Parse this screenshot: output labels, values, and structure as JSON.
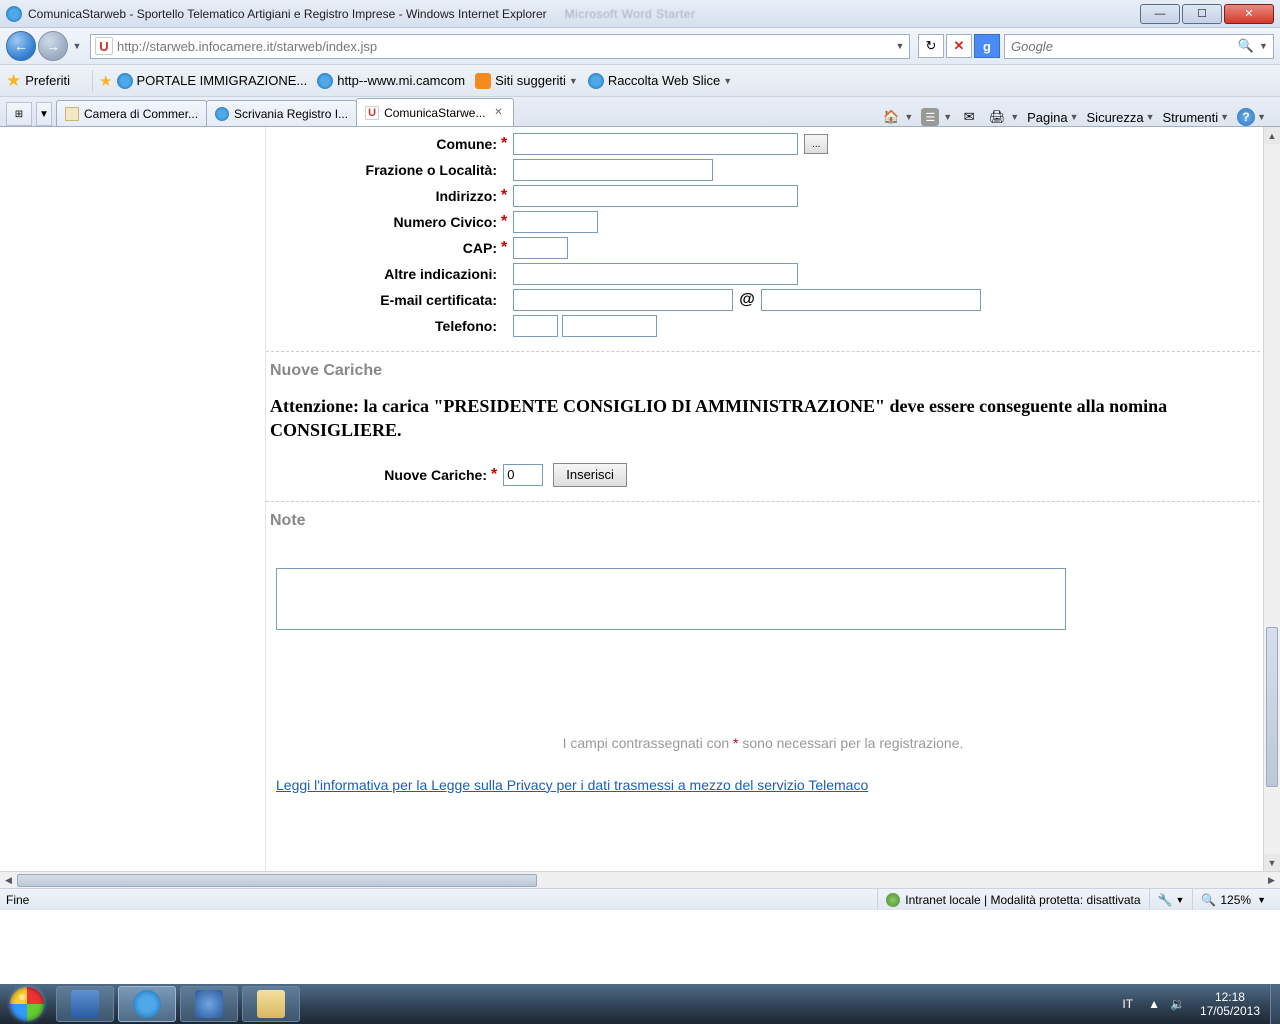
{
  "window": {
    "title": "ComunicaStarweb - Sportello Telematico Artigiani e Registro Imprese - Windows Internet Explorer",
    "blurred_inactive": "Microsoft Word Starter"
  },
  "address": {
    "url": "http://starweb.infocamere.it/starweb/index.jsp",
    "search_placeholder": "Google"
  },
  "favorites": {
    "label": "Preferiti",
    "items": [
      {
        "label": "PORTALE IMMIGRAZIONE..."
      },
      {
        "label": "http--www.mi.camcom"
      },
      {
        "label": "Siti suggeriti"
      },
      {
        "label": "Raccolta Web Slice"
      }
    ]
  },
  "tabs": [
    {
      "label": "Camera di Commer..."
    },
    {
      "label": "Scrivania Registro I..."
    },
    {
      "label": "ComunicaStarwe...",
      "active": true
    }
  ],
  "cmdbar": {
    "pagina": "Pagina",
    "sicurezza": "Sicurezza",
    "strumenti": "Strumenti"
  },
  "form": {
    "comune": "Comune:",
    "frazione": "Frazione o Località:",
    "indirizzo": "Indirizzo:",
    "civico": "Numero Civico:",
    "cap": "CAP:",
    "altre": "Altre indicazioni:",
    "email": "E-mail certificata:",
    "at": "@",
    "telefono": "Telefono:"
  },
  "nuove": {
    "title": "Nuove Cariche",
    "warn": "Attenzione: la carica \"PRESIDENTE CONSIGLIO DI AMMINISTRAZIONE\" deve essere conseguente alla nomina CONSIGLIERE.",
    "label": "Nuove Cariche:",
    "value": "0",
    "button": "Inserisci"
  },
  "note": {
    "title": "Note"
  },
  "footer": {
    "text_before": "I campi contrassegnati con ",
    "text_after": " sono necessari per la registrazione.",
    "privacy": "Leggi l'informativa per la Legge sulla Privacy per i dati trasmessi a mezzo del servizio Telemaco"
  },
  "status": {
    "left": "Fine",
    "zone": "Intranet locale | Modalità protetta: disattivata",
    "zoom": "125%"
  },
  "tray": {
    "lang": "IT",
    "time": "12:18",
    "date": "17/05/2013"
  }
}
